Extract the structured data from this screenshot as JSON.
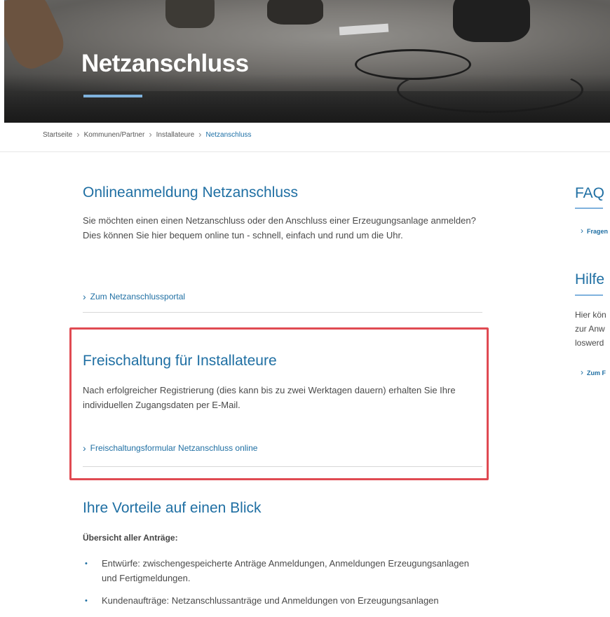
{
  "hero": {
    "title": "Netzanschluss"
  },
  "breadcrumb": {
    "items": [
      "Startseite",
      "Kommunen/Partner",
      "Installateure"
    ],
    "current": "Netzanschluss"
  },
  "section_online": {
    "title": "Onlineanmeldung Netzanschluss",
    "text": "Sie möchten einen einen Netzanschluss oder den Anschluss einer Erzeugungsanlage anmelden? Dies können Sie hier bequem online tun - schnell, einfach und rund um die Uhr.",
    "link": "Zum Netzanschlussportal"
  },
  "section_freischaltung": {
    "title": "Freischaltung für Installateure",
    "text": "Nach erfolgreicher Registrierung (dies kann bis zu zwei Werktagen dauern) erhalten Sie Ihre individuellen Zugangsdaten per E-Mail.",
    "link": "Freischaltungsformular Netzanschluss online"
  },
  "section_vorteile": {
    "title": "Ihre Vorteile auf einen Blick",
    "subtitle": "Übersicht aller Anträge:",
    "items": [
      "Entwürfe: zwischengespeicherte Anträge Anmeldungen, Anmeldungen Erzeugungsanlagen und Fertigmeldungen.",
      "Kundenaufträge: Netzanschlussanträge und Anmeldungen von Erzeugungsanlagen"
    ]
  },
  "sidebar": {
    "faq_title": "FAQ",
    "faq_link": "Fragen",
    "hilfe_title": "Hilfe",
    "hilfe_lines": [
      "Hier kön",
      "zur Anw",
      "loswerd"
    ],
    "hilfe_link": "Zum F"
  },
  "colors": {
    "accent": "#1f6fa3",
    "highlight": "#e04a52",
    "hero_underline": "#7fb2dd"
  },
  "icons": {
    "link_chevron": "chevron-right-icon"
  }
}
